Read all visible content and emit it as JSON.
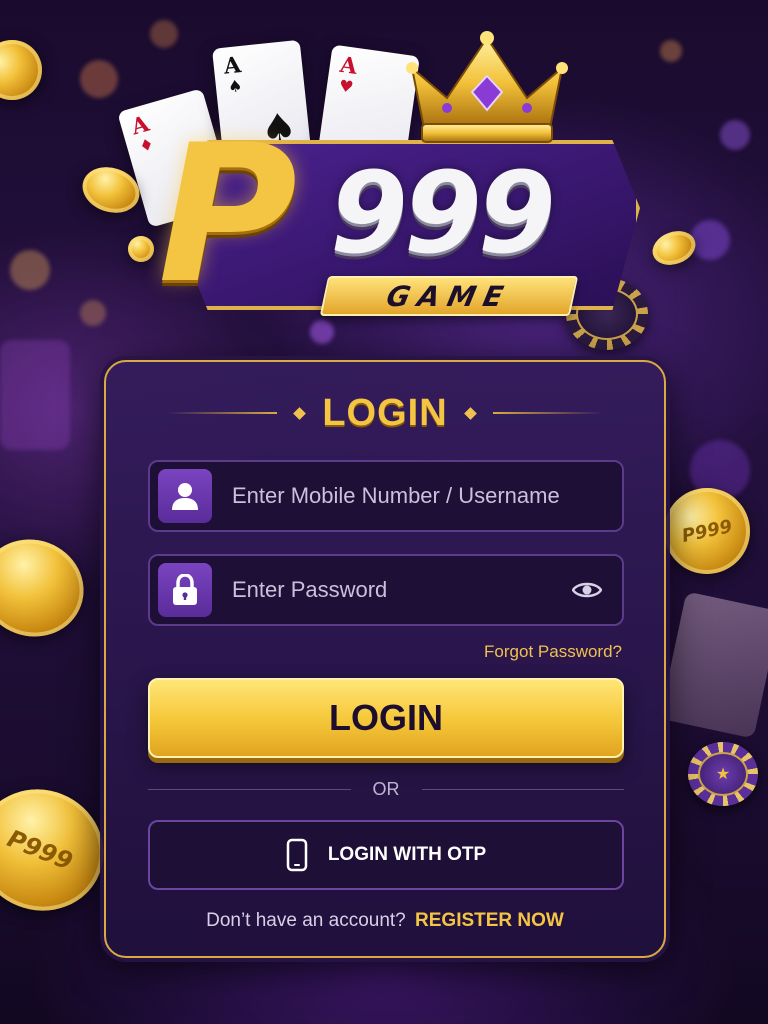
{
  "brand": {
    "logo_letter": "P",
    "logo_number": "999",
    "logo_sub": "GAME",
    "card_rank": "A"
  },
  "login_panel": {
    "title": "LOGIN",
    "username_field": {
      "placeholder": "Enter Mobile Number / Username",
      "value": "",
      "icon": "user-icon"
    },
    "password_field": {
      "placeholder": "Enter Password",
      "value": "",
      "icon": "lock-icon",
      "toggle_icon": "eye-icon"
    },
    "forgot_password": "Forgot Password?",
    "login_button": "LOGIN",
    "divider_text": "OR",
    "otp_button": {
      "label": "LOGIN WITH OTP",
      "icon": "phone-icon"
    },
    "register_prompt": "Don’t have an account?",
    "register_link": "REGISTER NOW"
  },
  "decor": {
    "coin_text": "P999"
  },
  "colors": {
    "accent_gold": "#f4c542",
    "panel_bg": "#341c5c",
    "field_bg": "#1e0f36",
    "icon_purple": "#7a44c0"
  }
}
